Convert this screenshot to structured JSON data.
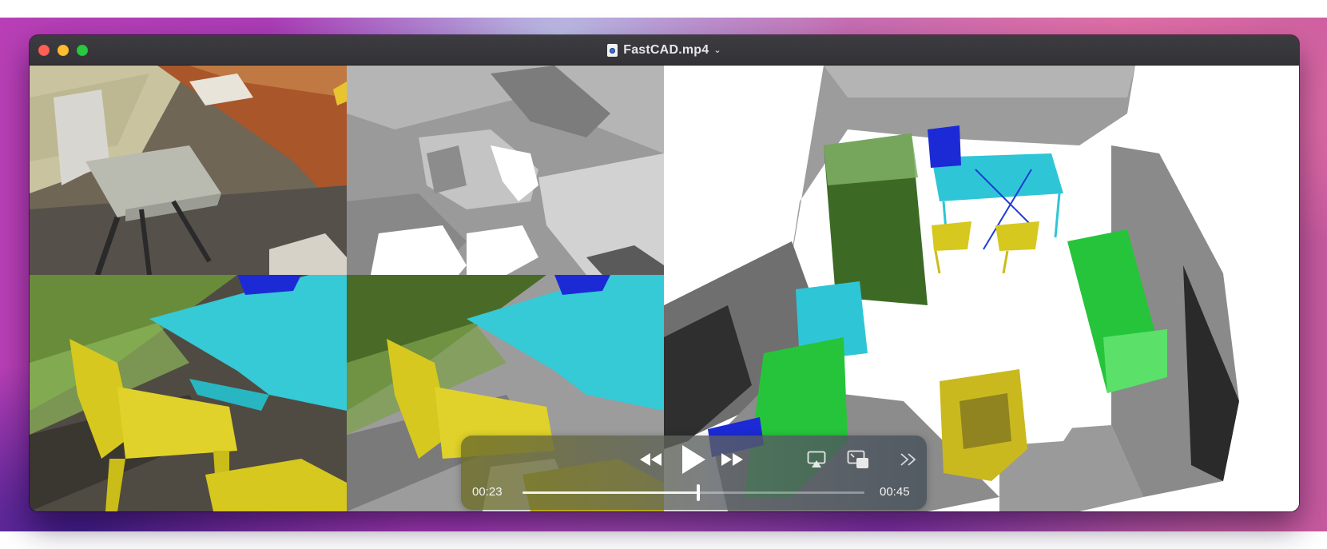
{
  "window": {
    "title": "FastCAD.mp4"
  },
  "player": {
    "current_time": "00:23",
    "duration": "00:45",
    "progress": 0.515
  },
  "icons": {
    "rewind": "rewind-icon",
    "play": "play-icon",
    "fast_forward": "fast-forward-icon",
    "airplay": "airplay-icon",
    "picture_in_picture": "picture-in-picture-icon",
    "more": "double-chevron-right-icon",
    "title_dropdown": "chevron-down-icon",
    "document": "video-file-icon"
  },
  "colors": {
    "bed": "#4c7a2c",
    "desk": "#2ec6d6",
    "chair": "#d6c81e",
    "monitor": "#1c2ad6",
    "cabinet": "#26c43a",
    "traffic_close": "#fe5f57",
    "traffic_minimize": "#febc2e",
    "traffic_maximize": "#28c840"
  }
}
